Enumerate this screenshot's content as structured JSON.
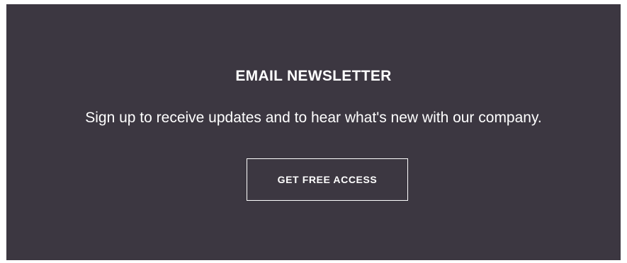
{
  "newsletter": {
    "title": "EMAIL NEWSLETTER",
    "description": "Sign up to receive updates and to hear what's new with our company.",
    "cta_label": "GET FREE ACCESS"
  },
  "colors": {
    "panel_background": "#3c3741",
    "text": "#ffffff",
    "button_border": "#ffffff"
  }
}
